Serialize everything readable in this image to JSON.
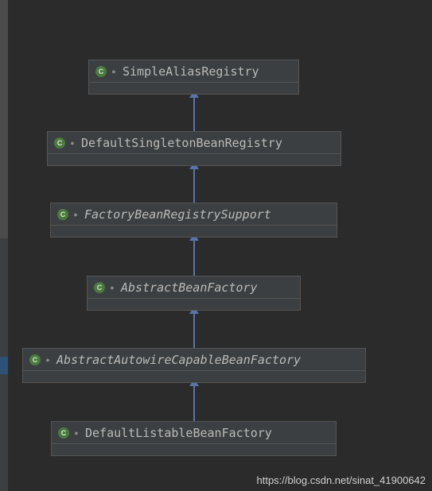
{
  "diagram": {
    "nodes": [
      {
        "name": "SimpleAliasRegistry",
        "abstract": false,
        "iconLetter": "C",
        "mod": "●"
      },
      {
        "name": "DefaultSingletonBeanRegistry",
        "abstract": false,
        "iconLetter": "C",
        "mod": "●"
      },
      {
        "name": "FactoryBeanRegistrySupport",
        "abstract": true,
        "iconLetter": "C",
        "mod": "●"
      },
      {
        "name": "AbstractBeanFactory",
        "abstract": true,
        "iconLetter": "C",
        "mod": "●"
      },
      {
        "name": "AbstractAutowireCapableBeanFactory",
        "abstract": true,
        "iconLetter": "C",
        "mod": "●"
      },
      {
        "name": "DefaultListableBeanFactory",
        "abstract": false,
        "iconLetter": "C",
        "mod": "●"
      }
    ],
    "edges": [
      {
        "from": 1,
        "to": 0,
        "type": "extends"
      },
      {
        "from": 2,
        "to": 1,
        "type": "extends"
      },
      {
        "from": 3,
        "to": 2,
        "type": "extends"
      },
      {
        "from": 4,
        "to": 3,
        "type": "extends"
      },
      {
        "from": 5,
        "to": 4,
        "type": "extends"
      }
    ]
  },
  "watermark": "https://blog.csdn.net/sinat_41900642"
}
